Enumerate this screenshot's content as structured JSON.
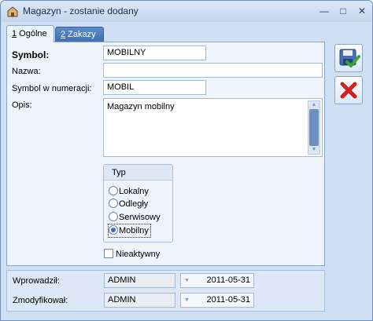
{
  "window": {
    "title": "Magazyn - zostanie dodany"
  },
  "titlebar_buttons": {
    "minimize": "—",
    "maximize": "□",
    "close": "✕"
  },
  "tabs": [
    {
      "key": "1",
      "label": " Ogólne"
    },
    {
      "key": "2",
      "label": " Zakazy"
    }
  ],
  "form": {
    "symbol": {
      "label": "Symbol:",
      "value": "MOBILNY"
    },
    "nazwa": {
      "label": "Nazwa:",
      "value": ""
    },
    "symbol_numeracji": {
      "label": "Symbol w numeracji:",
      "value": "MOBIL"
    },
    "opis": {
      "label": "Opis:",
      "value": "Magazyn mobilny"
    }
  },
  "typ": {
    "title": "Typ",
    "options": [
      "Lokalny",
      "Odległy",
      "Serwisowy",
      "Mobilny"
    ],
    "selected": "Mobilny"
  },
  "nieaktywny": {
    "label": "Nieaktywny",
    "checked": false
  },
  "footer": {
    "wprowadzil": {
      "label": "Wprowadził:",
      "user": "ADMIN",
      "date": "2011-05-31"
    },
    "zmodyfikowal": {
      "label": "Zmodyfikował:",
      "user": "ADMIN",
      "date": "2011-05-31"
    }
  },
  "colors": {
    "accent": "#3d6ec0",
    "cancel": "#d42020",
    "save_check": "#3aa53a"
  },
  "icons": {
    "save": "save-icon",
    "cancel": "cancel-icon",
    "app": "warehouse-icon"
  }
}
